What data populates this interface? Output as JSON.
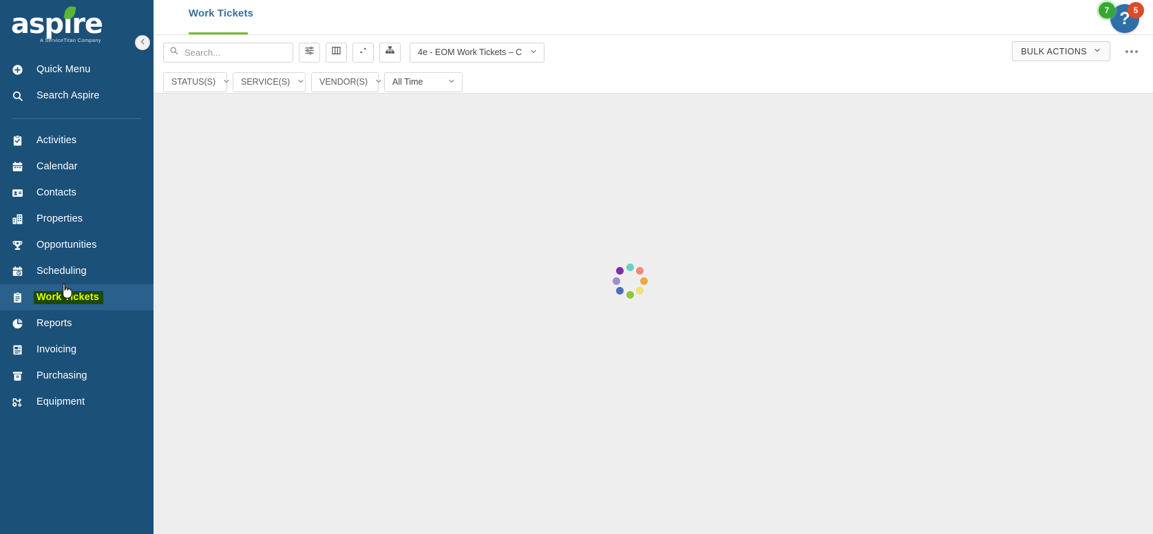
{
  "brand": {
    "name": "aspire",
    "tagline": "A ServiceTitan Company",
    "trademark": "™",
    "leaf_color": "#5cb531",
    "sidebar_color": "#1b5079"
  },
  "sidebar": {
    "collapse_icon": "chevron-left-icon",
    "top_items": [
      {
        "label": "Quick Menu",
        "icon": "plus-circle-icon"
      },
      {
        "label": "Search Aspire",
        "icon": "search-icon"
      }
    ],
    "items": [
      {
        "label": "Activities",
        "icon": "clipboard-check-icon",
        "active": false
      },
      {
        "label": "Calendar",
        "icon": "calendar-icon",
        "active": false
      },
      {
        "label": "Contacts",
        "icon": "contact-card-icon",
        "active": false
      },
      {
        "label": "Properties",
        "icon": "building-icon",
        "active": false
      },
      {
        "label": "Opportunities",
        "icon": "trophy-icon",
        "active": false
      },
      {
        "label": "Scheduling",
        "icon": "schedule-clock-icon",
        "active": false
      },
      {
        "label": "Work Tickets",
        "icon": "clipboard-icon",
        "active": true
      },
      {
        "label": "Reports",
        "icon": "pie-chart-icon",
        "active": false
      },
      {
        "label": "Invoicing",
        "icon": "invoice-icon",
        "active": false
      },
      {
        "label": "Purchasing",
        "icon": "purchase-bag-icon",
        "active": false
      },
      {
        "label": "Equipment",
        "icon": "equipment-icon",
        "active": false
      }
    ],
    "highlight": {
      "text_color": "#ddff00",
      "background_color": "#1d4a00"
    }
  },
  "header": {
    "tabs": [
      {
        "label": "Work Tickets",
        "active": true
      }
    ],
    "active_tab_color": "#78bb2b",
    "help": {
      "icon": "question-mark-icon",
      "badge_left": "7",
      "badge_left_color": "#35a832",
      "badge_right": "5",
      "badge_right_color": "#dc4a27"
    }
  },
  "toolbar": {
    "search": {
      "placeholder": "Search...",
      "value": "",
      "icon": "search-icon"
    },
    "buttons": [
      {
        "icon": "filter-sliders-icon",
        "name": "filter-settings-button"
      },
      {
        "icon": "columns-icon",
        "name": "columns-button"
      },
      {
        "icon": "sort-arrows-icon",
        "name": "sort-button"
      },
      {
        "icon": "hierarchy-icon",
        "name": "hierarchy-button"
      }
    ],
    "view_select": {
      "value": "4e - EOM Work Tickets – C",
      "icon": "chevron-down-icon"
    },
    "bulk_actions": {
      "label": "BULK ACTIONS",
      "icon": "chevron-down-icon"
    },
    "more_menu": {
      "icon": "ellipsis-icon"
    }
  },
  "filters": [
    {
      "label": "STATUS(S)",
      "icon": "chevron-down-icon"
    },
    {
      "label": "SERVICE(S)",
      "icon": "chevron-down-icon"
    },
    {
      "label": "VENDOR(S)",
      "icon": "chevron-down-icon"
    },
    {
      "label": "All Time",
      "icon": "chevron-down-icon"
    }
  ],
  "content": {
    "state": "loading",
    "spinner": {
      "name": "loading-spinner",
      "dots": [
        {
          "color": "#6bcfc0",
          "angle": 270
        },
        {
          "color": "#f08a78",
          "angle": 315
        },
        {
          "color": "#f0a93c",
          "angle": 0
        },
        {
          "color": "#f2e07a",
          "angle": 45
        },
        {
          "color": "#8cc63f",
          "angle": 90
        },
        {
          "color": "#4a6fb5",
          "angle": 135
        },
        {
          "color": "#9b8ed0",
          "angle": 180
        },
        {
          "color": "#7d2fa8",
          "angle": 225
        }
      ]
    },
    "background_color": "#eeeeee"
  }
}
